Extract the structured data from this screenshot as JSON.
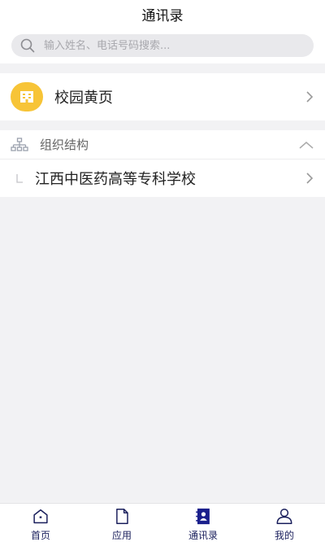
{
  "header": {
    "title": "通讯录"
  },
  "search": {
    "placeholder": "输入姓名、电话号码搜索..."
  },
  "yellow_pages": {
    "label": "校园黄页"
  },
  "org": {
    "header_label": "组织结构",
    "items": [
      {
        "label": "江西中医药高等专科学校"
      }
    ]
  },
  "tabbar": {
    "items": [
      {
        "label": "首页",
        "icon": "home-icon"
      },
      {
        "label": "应用",
        "icon": "document-icon"
      },
      {
        "label": "通讯录",
        "icon": "contacts-icon",
        "active": true
      },
      {
        "label": "我的",
        "icon": "user-icon"
      }
    ]
  },
  "colors": {
    "accent": "#1a1f8c",
    "yellow": "#f7c437",
    "background": "#f2f2f4"
  }
}
